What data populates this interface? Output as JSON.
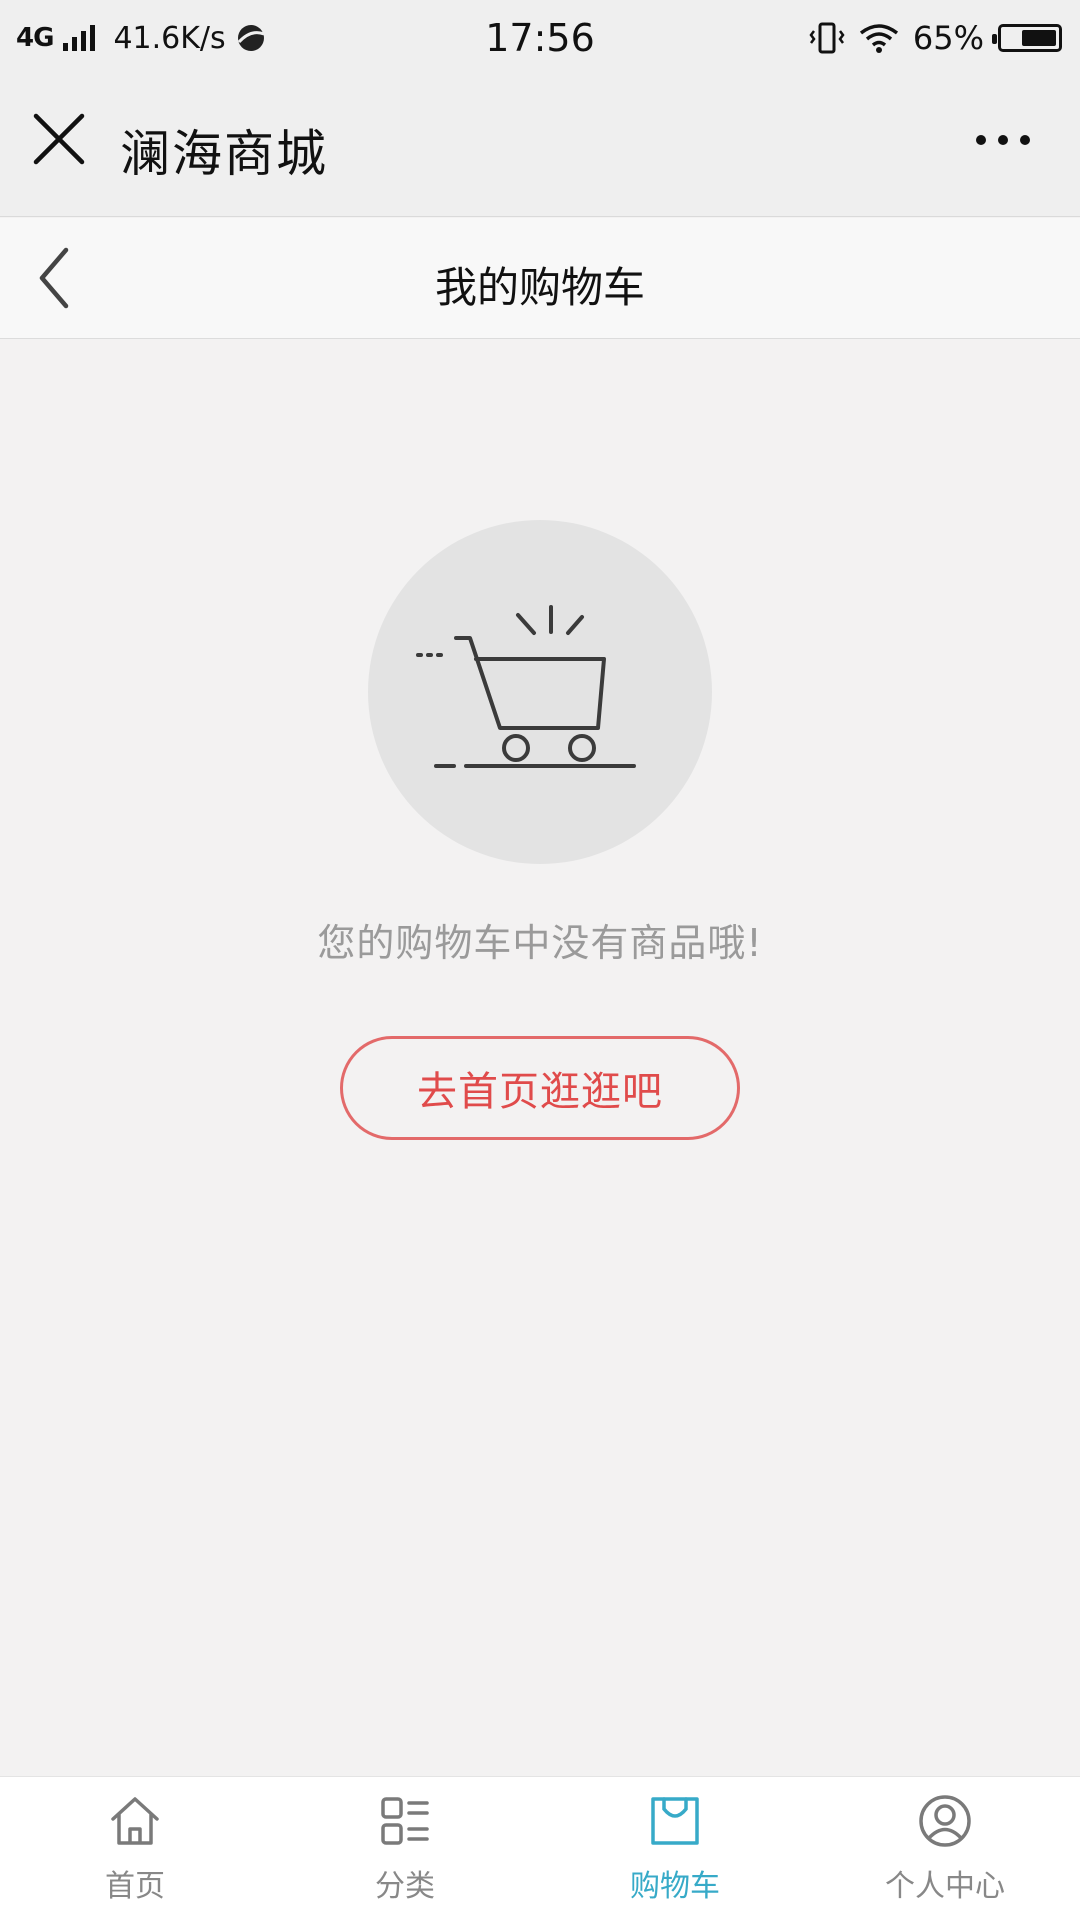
{
  "status_bar": {
    "network": "4G",
    "speed": "41.6K/s",
    "time": "17:56",
    "battery": "65%",
    "battery_level": 0.65,
    "icons": [
      "signal-icon",
      "browser-icon",
      "vibrate-icon",
      "wifi-icon",
      "battery-icon"
    ]
  },
  "header": {
    "title": "澜海商城",
    "close_icon": "close-icon",
    "more_icon": "more-icon"
  },
  "nav": {
    "title": "我的购物车",
    "back_icon": "back-chevron-icon"
  },
  "empty_state": {
    "icon": "shopping-cart-icon",
    "message": "您的购物车中没有商品哦!",
    "button_label": "去首页逛逛吧"
  },
  "tabs": [
    {
      "label": "首页",
      "icon": "home-icon",
      "active": false
    },
    {
      "label": "分类",
      "icon": "category-icon",
      "active": false
    },
    {
      "label": "购物车",
      "icon": "cart-bag-icon",
      "active": true
    },
    {
      "label": "个人中心",
      "icon": "user-icon",
      "active": false
    }
  ],
  "colors": {
    "background": "#f3f2f2",
    "accent_red": "#e04b4b",
    "tab_active": "#37aac8",
    "tab_inactive": "#888888"
  }
}
